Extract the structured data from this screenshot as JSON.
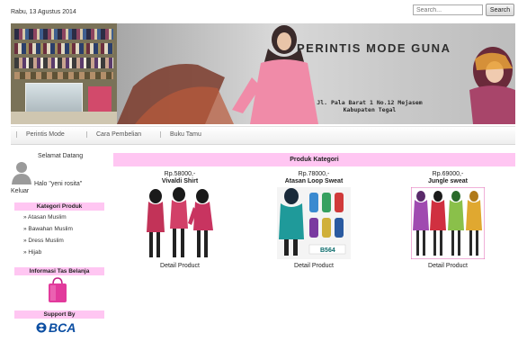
{
  "header": {
    "date": "Rabu, 13 Agustus 2014",
    "search_placeholder": "Search...",
    "search_button": "Search"
  },
  "banner": {
    "title": "PERINTIS MODE GUNA",
    "address_line1": "Jl. Pala Barat 1 No.12 Mejasem",
    "address_line2": "Kabupaten Tegal"
  },
  "nav": [
    "Perintis Mode",
    "Cara Pembelian",
    "Buku Tamu"
  ],
  "sidebar": {
    "welcome": "Selamat Datang",
    "greeting": "Halo \"yeni rosita\"",
    "logout": "Keluar",
    "category_header": "Kategori Produk",
    "categories": [
      "» Atasan Muslim",
      "» Bawahan Muslim",
      "» Dress Muslim",
      "» Hijab"
    ],
    "cart_header": "Informasi Tas Belanja",
    "support_header": "Support By",
    "support_logo": "BCA"
  },
  "content": {
    "header": "Produk Kategori",
    "detail_label": "Detail Product",
    "products": [
      {
        "price": "Rp.58000,-",
        "name": "Vivaldi Shirt"
      },
      {
        "price": "Rp.78000,-",
        "name": "Atasan Loop Sweat"
      },
      {
        "price": "Rp.69000,-",
        "name": "Jungle sweat"
      }
    ]
  },
  "colors": {
    "accent_pink": "#ffc6f2",
    "bca_blue": "#0b4ea2"
  },
  "icons": [
    "user-avatar-icon",
    "shopping-bag-icon",
    "bca-logo-icon"
  ]
}
